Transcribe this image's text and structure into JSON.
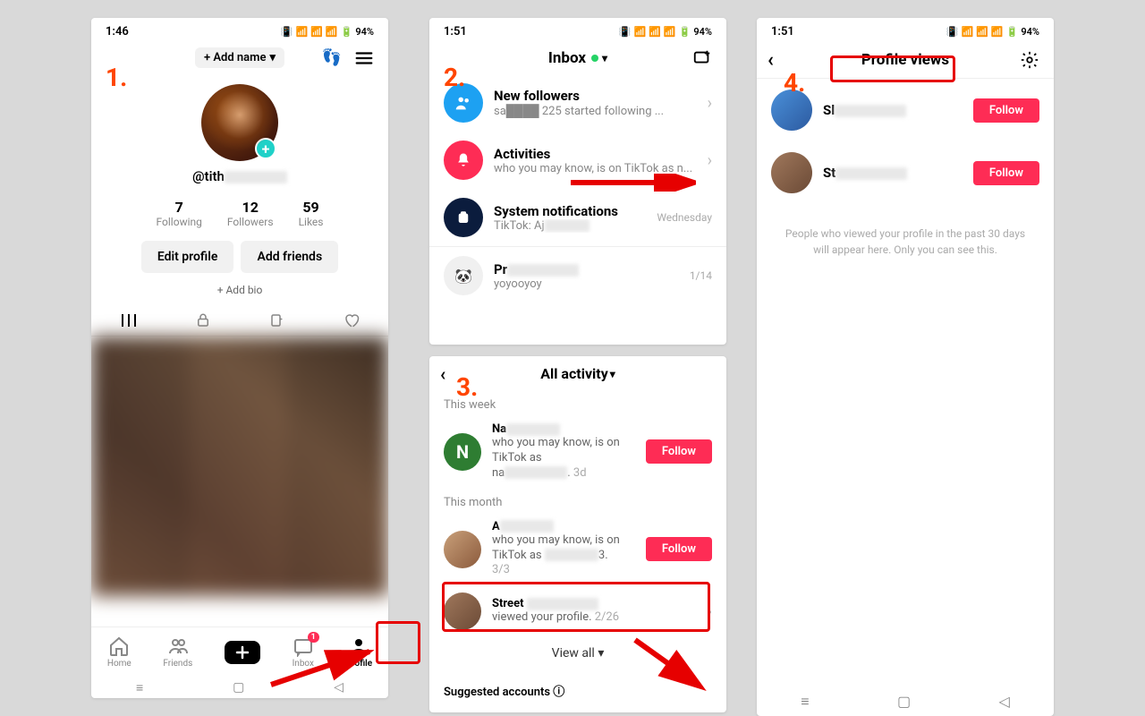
{
  "status": {
    "time1": "1:46",
    "time2": "1:51",
    "battery": "94%"
  },
  "steps": {
    "s1": "1.",
    "s2": "2.",
    "s3": "3.",
    "s4": "4."
  },
  "profile": {
    "add_name": "+ Add name",
    "username": "@tith",
    "following_num": "7",
    "following_label": "Following",
    "followers_num": "12",
    "followers_label": "Followers",
    "likes_num": "59",
    "likes_label": "Likes",
    "edit_profile": "Edit profile",
    "add_friends": "Add friends",
    "add_bio": "+ Add bio"
  },
  "nav": {
    "home": "Home",
    "friends": "Friends",
    "inbox": "Inbox",
    "profile": "Profile",
    "inbox_badge": "1"
  },
  "inbox": {
    "title": "Inbox",
    "new_followers": {
      "title": "New followers",
      "sub": "sa████ 225 started following ..."
    },
    "activities": {
      "title": "Activities",
      "sub": "who you may know, is on TikTok as n..."
    },
    "system": {
      "title": "System notifications",
      "sub": "TikTok: Aj",
      "time": "Wednesday"
    },
    "dm": {
      "title": "Pr",
      "sub": "yoyooyoy",
      "time": "1/14"
    }
  },
  "activity": {
    "header": "All activity",
    "this_week": "This week",
    "this_month": "This month",
    "item1": {
      "name": "Na",
      "text": "who you may know, is on TikTok as",
      "handle": "na",
      "date": "3d"
    },
    "item2": {
      "name": "A",
      "text": "who you may know, is on TikTok as",
      "handle": "3.",
      "date": "3/3"
    },
    "item3": {
      "name": "Street",
      "text": "viewed your profile.",
      "date": "2/26"
    },
    "follow": "Follow",
    "view_all": "View all",
    "suggested": "Suggested accounts"
  },
  "profile_views": {
    "title": "Profile views",
    "user1": "Sl",
    "user2": "St",
    "follow": "Follow",
    "note": "People who viewed your profile in the past 30 days will appear here. Only you can see this."
  }
}
